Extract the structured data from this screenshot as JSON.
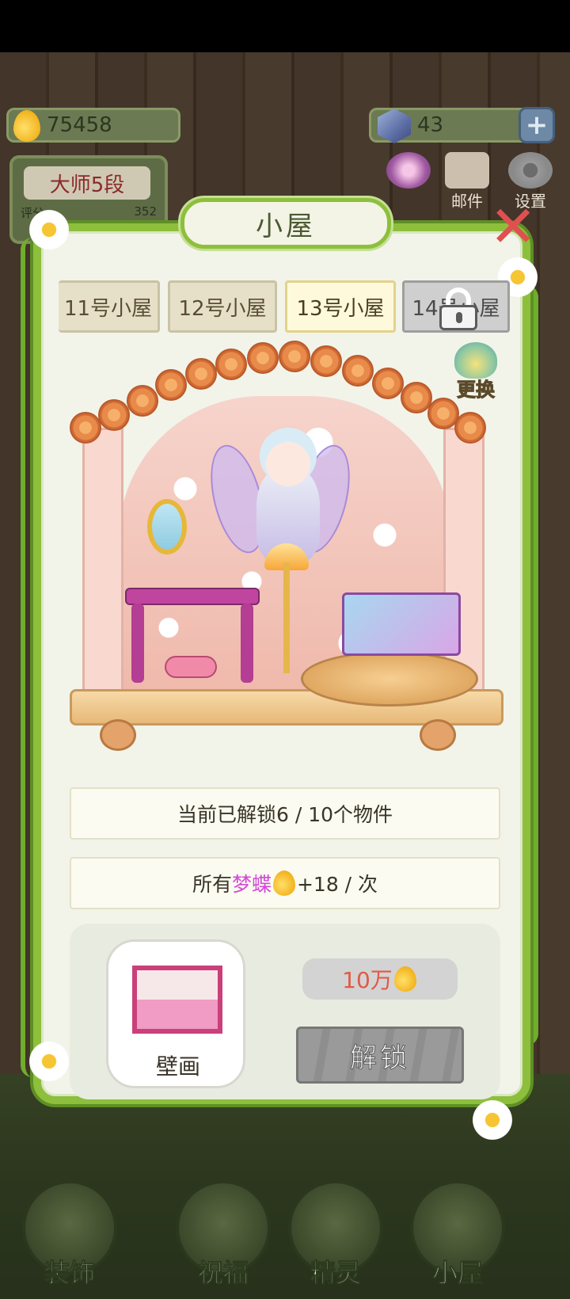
{
  "resources": {
    "gold": "75458",
    "gems": "43"
  },
  "rank": {
    "title": "大师5段",
    "label": "评分",
    "value": "352"
  },
  "top_icons": {
    "mail_label": "邮件",
    "settings_label": "设置"
  },
  "dialog": {
    "title": "小屋",
    "tabs": [
      "11号小屋",
      "12号小屋",
      "13号小屋",
      "14号小屋"
    ],
    "selected_tab": "13号小屋",
    "change_label": "更换",
    "unlocked_text": "当前已解锁6 / 10个物件",
    "bonus": {
      "prefix": "所有",
      "name": "梦蝶",
      "suffix": "+18 / 次"
    },
    "item": {
      "name": "壁画",
      "price": "10万",
      "unlock_label": "解锁"
    }
  },
  "bottom_nav": [
    "装饰",
    "祝福",
    "精灵",
    "小屋"
  ],
  "colors": {
    "accent_green": "#8dbf3c",
    "price_red": "#e05a46",
    "name_pink": "#d14ad6"
  }
}
